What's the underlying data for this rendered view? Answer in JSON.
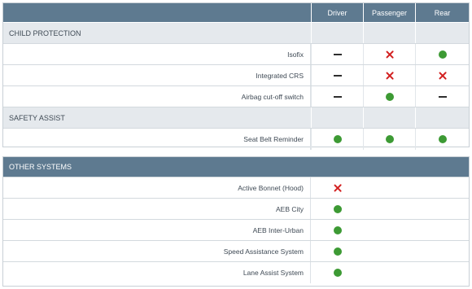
{
  "colors": {
    "header_bg": "#5e7a90",
    "section_bg": "#e5e9ed",
    "good": "#3d9a34",
    "bad": "#d21f1f",
    "none": "#2e2e2e"
  },
  "table1": {
    "columns": [
      "Driver",
      "Passenger",
      "Rear"
    ],
    "sections": [
      {
        "title": "CHILD PROTECTION",
        "rows": [
          {
            "label": "Isofix",
            "values": [
              "dash-icon",
              "cross-icon",
              "dot-icon"
            ]
          },
          {
            "label": "Integrated CRS",
            "values": [
              "dash-icon",
              "cross-icon",
              "cross-icon"
            ]
          },
          {
            "label": "Airbag cut-off switch",
            "values": [
              "dash-icon",
              "dot-icon",
              "dash-icon"
            ]
          }
        ]
      },
      {
        "title": "SAFETY ASSIST",
        "rows": [
          {
            "label": "Seat Belt Reminder",
            "values": [
              "dot-icon",
              "dot-icon",
              "dot-icon"
            ]
          }
        ]
      }
    ]
  },
  "table2": {
    "title": "OTHER SYSTEMS",
    "rows": [
      {
        "label": "Active Bonnet (Hood)",
        "value": "cross-icon"
      },
      {
        "label": "AEB City",
        "value": "dot-icon"
      },
      {
        "label": "AEB Inter-Urban",
        "value": "dot-icon"
      },
      {
        "label": "Speed Assistance System",
        "value": "dot-icon"
      },
      {
        "label": "Lane Assist System",
        "value": "dot-icon"
      }
    ]
  }
}
